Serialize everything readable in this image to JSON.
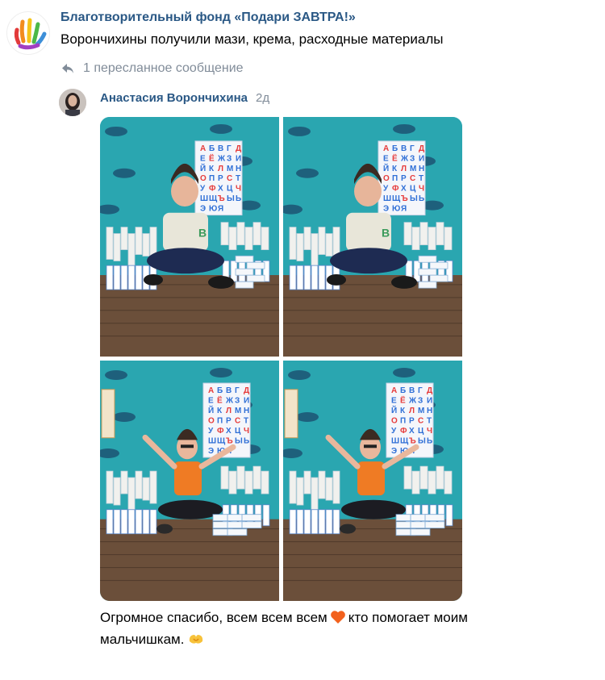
{
  "post": {
    "org_name": "Благотворительный фонд «Подари ЗАВТРА!»",
    "text": "Ворончихины получили мази, крема, расходные материалы",
    "avatar_icon": "colorful-hand-logo-icon"
  },
  "forwarded": {
    "label": "1 пересланное сообщение",
    "icon": "reply-arrow-icon"
  },
  "message": {
    "author": "Анастасия Ворончихина",
    "time": "2д",
    "text_part1": "Огромное спасибо, всем всем всем",
    "text_part2": "кто помогает  моим мальчишкам.",
    "emoji_heart": "orange-heart-icon",
    "emoji_hands": "heart-hands-icon",
    "photos": [
      {
        "subject": "boy-with-cosmetics-photo"
      },
      {
        "subject": "boy-with-cosmetics-photo"
      },
      {
        "subject": "boy-arms-raised-photo"
      },
      {
        "subject": "boy-arms-raised-photo"
      }
    ]
  },
  "poster": {
    "letters": [
      "А",
      "Б",
      "В",
      "Г",
      "Д",
      "Е",
      "Ё",
      "Ж",
      "З",
      "И",
      "Й",
      "К",
      "Л",
      "М",
      "Н",
      "О",
      "П",
      "Р",
      "С",
      "Т",
      "У",
      "Ф",
      "Х",
      "Ц",
      "Ч",
      "Ш",
      "Щ",
      "Ъ",
      "Ы",
      "Ь",
      "Э",
      "Ю",
      "Я"
    ]
  },
  "colors": {
    "link": "#2a5885",
    "muted": "#818c99",
    "wall": "#2aa6b0",
    "floor": "#6b4f3a"
  }
}
